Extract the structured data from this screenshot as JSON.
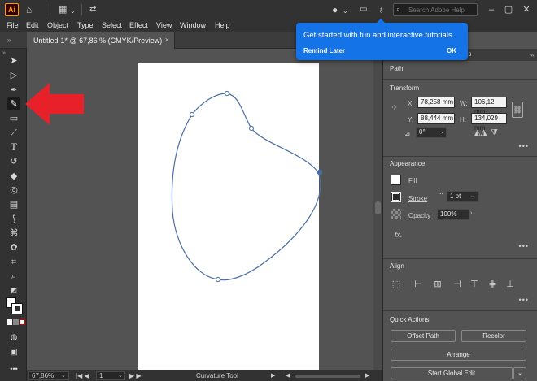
{
  "app": {
    "logo": "Ai"
  },
  "titlebar": {
    "icons": [
      "home-icon",
      "workspace-icon",
      "arrange-icon",
      "user-icon",
      "panel-icon",
      "lightbulb-icon"
    ],
    "search": {
      "placeholder": "Search Adobe Help"
    },
    "window_controls": [
      "minimize-icon",
      "maximize-icon",
      "close-icon"
    ]
  },
  "menu": {
    "items": [
      "File",
      "Edit",
      "Object",
      "Type",
      "Select",
      "Effect",
      "View",
      "Window",
      "Help"
    ]
  },
  "document": {
    "tab_label": "Untitled-1* @ 67,86 % (CMYK/Preview)",
    "close_glyph": "×"
  },
  "tooltip": {
    "message": "Get started with fun and interactive tutorials.",
    "remind_label": "Remind Later",
    "ok_label": "OK"
  },
  "tools": [
    "selection-tool",
    "direct-selection-tool",
    "pen-tool",
    "curvature-tool",
    "rectangle-tool",
    "paintbrush-tool",
    "type-tool",
    "rotate-tool",
    "eraser-tool",
    "shape-builder-tool",
    "gradient-tool",
    "eyedropper-tool",
    "blend-tool",
    "symbol-sprayer-tool",
    "artboard-tool",
    "zoom-tool"
  ],
  "panel": {
    "tab_fragment": "aries",
    "path_label": "Path",
    "transform": {
      "title": "Transform",
      "x_label": "X:",
      "x_value": "78,258 mm",
      "y_label": "Y:",
      "y_value": "88,444 mm",
      "w_label": "W:",
      "w_value": "106,12 mm",
      "h_label": "H:",
      "h_value": "134,029 mm",
      "angle_value": "0°"
    },
    "appearance": {
      "title": "Appearance",
      "fill_label": "Fill",
      "stroke_label": "Stroke",
      "stroke_value": "1 pt",
      "opacity_label": "Opacity",
      "opacity_value": "100%",
      "fx_label": "fx."
    },
    "align": {
      "title": "Align"
    },
    "quick_actions": {
      "title": "Quick Actions",
      "offset_path": "Offset Path",
      "recolor": "Recolor",
      "arrange": "Arrange",
      "global_edit": "Start Global Edit"
    },
    "more_glyph": "•••"
  },
  "status": {
    "zoom": "67,86%",
    "artboard": "1",
    "tool_name": "Curvature Tool"
  },
  "colors": {
    "accent": "#1473e6",
    "path_stroke": "#4a6fa5",
    "annotation_arrow": "#e8202a"
  }
}
